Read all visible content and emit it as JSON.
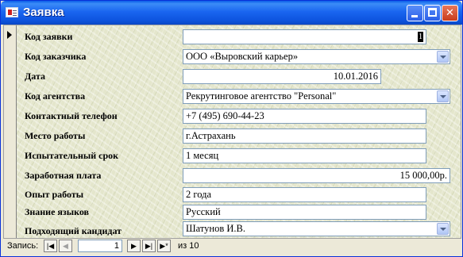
{
  "window": {
    "title": "Заявка"
  },
  "fields": [
    {
      "label": "Код заявки",
      "value": "1",
      "type": "id"
    },
    {
      "label": "Код заказчика",
      "value": "ООО «Выровский карьер»",
      "type": "combo"
    },
    {
      "label": "Дата",
      "value": "10.01.2016",
      "type": "date"
    },
    {
      "label": "Код агентства",
      "value": "Рекрутинговое агентство \"Personal\"",
      "type": "combo"
    },
    {
      "label": "Контактный телефон",
      "value": "+7 (495) 690-44-23",
      "type": "text"
    },
    {
      "label": "Место работы",
      "value": "г.Астрахань",
      "type": "text"
    },
    {
      "label": "Испытательный срок",
      "value": "1 месяц",
      "type": "text"
    },
    {
      "label": "Заработная плата",
      "value": "15 000,00р.",
      "type": "currency"
    },
    {
      "label": "Опыт работы",
      "value": "2 года",
      "type": "text"
    },
    {
      "label": "Знание языков",
      "value": "Русский",
      "type": "text"
    },
    {
      "label": "Подходящий кандидат",
      "value": "Шатунов И.В.",
      "type": "combo"
    }
  ],
  "navigation": {
    "record_label": "Запись:",
    "current_record": "1",
    "total_text": "из  10",
    "first_icon": "first-record-icon",
    "prev_icon": "previous-record-icon",
    "next_icon": "next-record-icon",
    "last_icon": "last-record-icon",
    "new_icon": "new-record-icon"
  },
  "colors": {
    "titlebar": "#0a5ce8",
    "form_background": "#e4e6cc",
    "field_border": "#7f9db9"
  }
}
